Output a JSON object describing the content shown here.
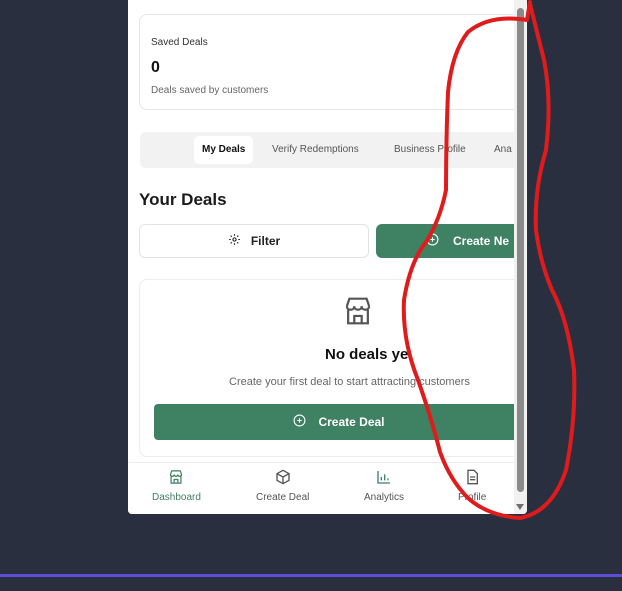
{
  "stat_card": {
    "label": "Saved Deals",
    "value": "0",
    "subtitle": "Deals saved by customers"
  },
  "tabs": [
    {
      "label": "My Deals",
      "active": true
    },
    {
      "label": "Verify Redemptions",
      "active": false
    },
    {
      "label": "Business Profile",
      "active": false
    },
    {
      "label": "Ana",
      "active": false
    }
  ],
  "section": {
    "title": "Your Deals",
    "filter_label": "Filter",
    "create_new_label": "Create Ne"
  },
  "empty_state": {
    "icon": "store-icon",
    "title": "No deals ye",
    "subtitle": "Create your first deal to start attracting customers",
    "button_label": "Create Deal"
  },
  "bottom_nav": [
    {
      "label": "Dashboard",
      "icon": "store-icon",
      "active": true
    },
    {
      "label": "Create Deal",
      "icon": "box-icon",
      "active": false
    },
    {
      "label": "Analytics",
      "icon": "bar-chart-icon",
      "active": false
    },
    {
      "label": "Profile",
      "icon": "document-icon",
      "active": false
    }
  ],
  "colors": {
    "background": "#2a2f40",
    "accent": "#3f8163",
    "annotation": "#e01b1b",
    "underline": "#5a4fd6"
  }
}
